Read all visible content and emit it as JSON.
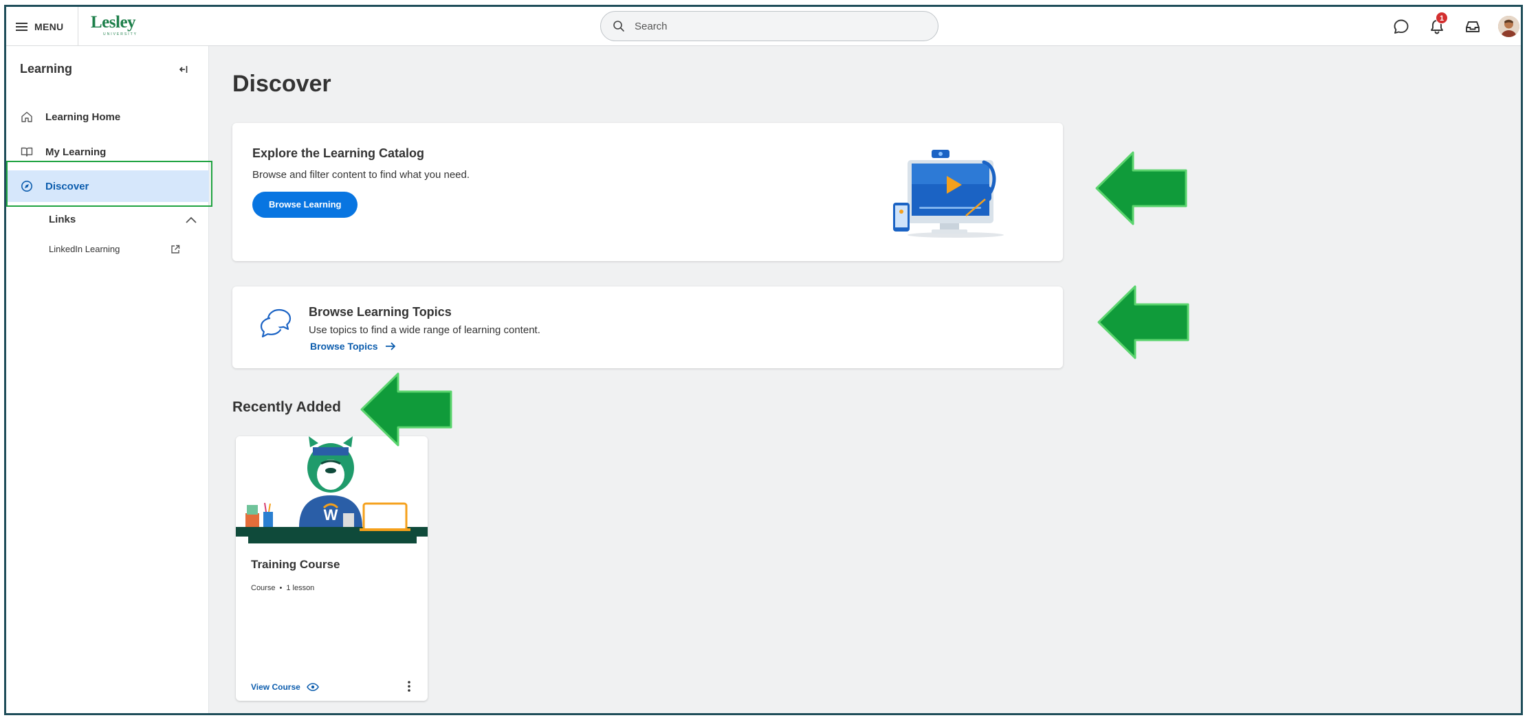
{
  "topbar": {
    "menu_label": "MENU",
    "logo_text": "Lesley",
    "logo_sub": "UNIVERSITY",
    "search_placeholder": "Search",
    "notification_count": "1",
    "icons": [
      "chat-icon",
      "bell-icon",
      "inbox-icon",
      "avatar"
    ]
  },
  "sidebar": {
    "title": "Learning",
    "items": [
      {
        "label": "Learning Home",
        "icon": "home-icon"
      },
      {
        "label": "My Learning",
        "icon": "book-icon"
      },
      {
        "label": "Discover",
        "icon": "compass-icon",
        "active": true
      }
    ],
    "links_heading": "Links",
    "links": [
      {
        "label": "LinkedIn Learning",
        "icon": "external-link-icon"
      }
    ]
  },
  "main": {
    "page_title": "Discover",
    "catalog_card": {
      "heading": "Explore the Learning Catalog",
      "description": "Browse and filter content to find what you need.",
      "button": "Browse Learning"
    },
    "topics_card": {
      "heading": "Browse Learning Topics",
      "description": "Use topics to find a wide range of learning content.",
      "link": "Browse Topics"
    },
    "recently_added_title": "Recently Added",
    "courses": [
      {
        "title": "Training Course",
        "type": "Course",
        "separator": "•",
        "lessons": "1 lesson",
        "action": "View Course"
      }
    ]
  },
  "colors": {
    "accent_blue": "#0875e1",
    "link_blue": "#0b5cad",
    "active_bg": "#d6e7fb",
    "annotation_green": "#1fa340",
    "brand_green": "#1d7f4a",
    "frame_border": "#1f4e5a"
  }
}
